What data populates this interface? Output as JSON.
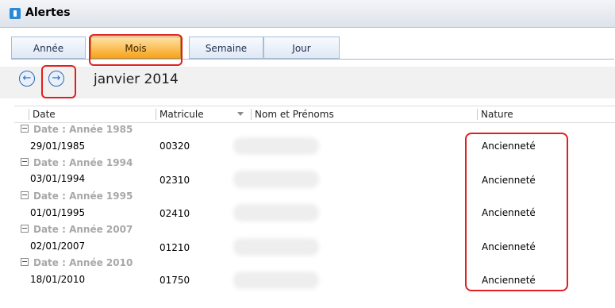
{
  "window": {
    "title": "Alertes",
    "brand_color": "#2a8ad8"
  },
  "view_tabs": [
    {
      "label": "Année",
      "active": false
    },
    {
      "label": "Mois",
      "active": true
    },
    {
      "label": "Semaine",
      "active": false
    },
    {
      "label": "Jour",
      "active": false
    }
  ],
  "navigator": {
    "prev_icon": "←",
    "next_icon": "→",
    "period": "janvier 2014"
  },
  "grid": {
    "columns": {
      "date": "Date",
      "matricule": "Matricule",
      "nom": "Nom et Prénoms",
      "nature": "Nature"
    },
    "groups": [
      {
        "label": "Date : Année 1985",
        "row": {
          "date": "29/01/1985",
          "matricule": "00320",
          "nature": "Ancienneté"
        }
      },
      {
        "label": "Date : Année 1994",
        "row": {
          "date": "03/01/1994",
          "matricule": "02310",
          "nature": "Ancienneté"
        }
      },
      {
        "label": "Date : Année 1995",
        "row": {
          "date": "01/01/1995",
          "matricule": "02410",
          "nature": "Ancienneté"
        }
      },
      {
        "label": "Date : Année 2007",
        "row": {
          "date": "02/01/2007",
          "matricule": "01210",
          "nature": "Ancienneté"
        }
      },
      {
        "label": "Date : Année 2010",
        "row": {
          "date": "18/01/2010",
          "matricule": "01750",
          "nature": "Ancienneté"
        }
      }
    ]
  },
  "colors": {
    "active_tab": "#f7a21a",
    "highlight": "#e02020",
    "group_text": "#a8a8a8"
  }
}
